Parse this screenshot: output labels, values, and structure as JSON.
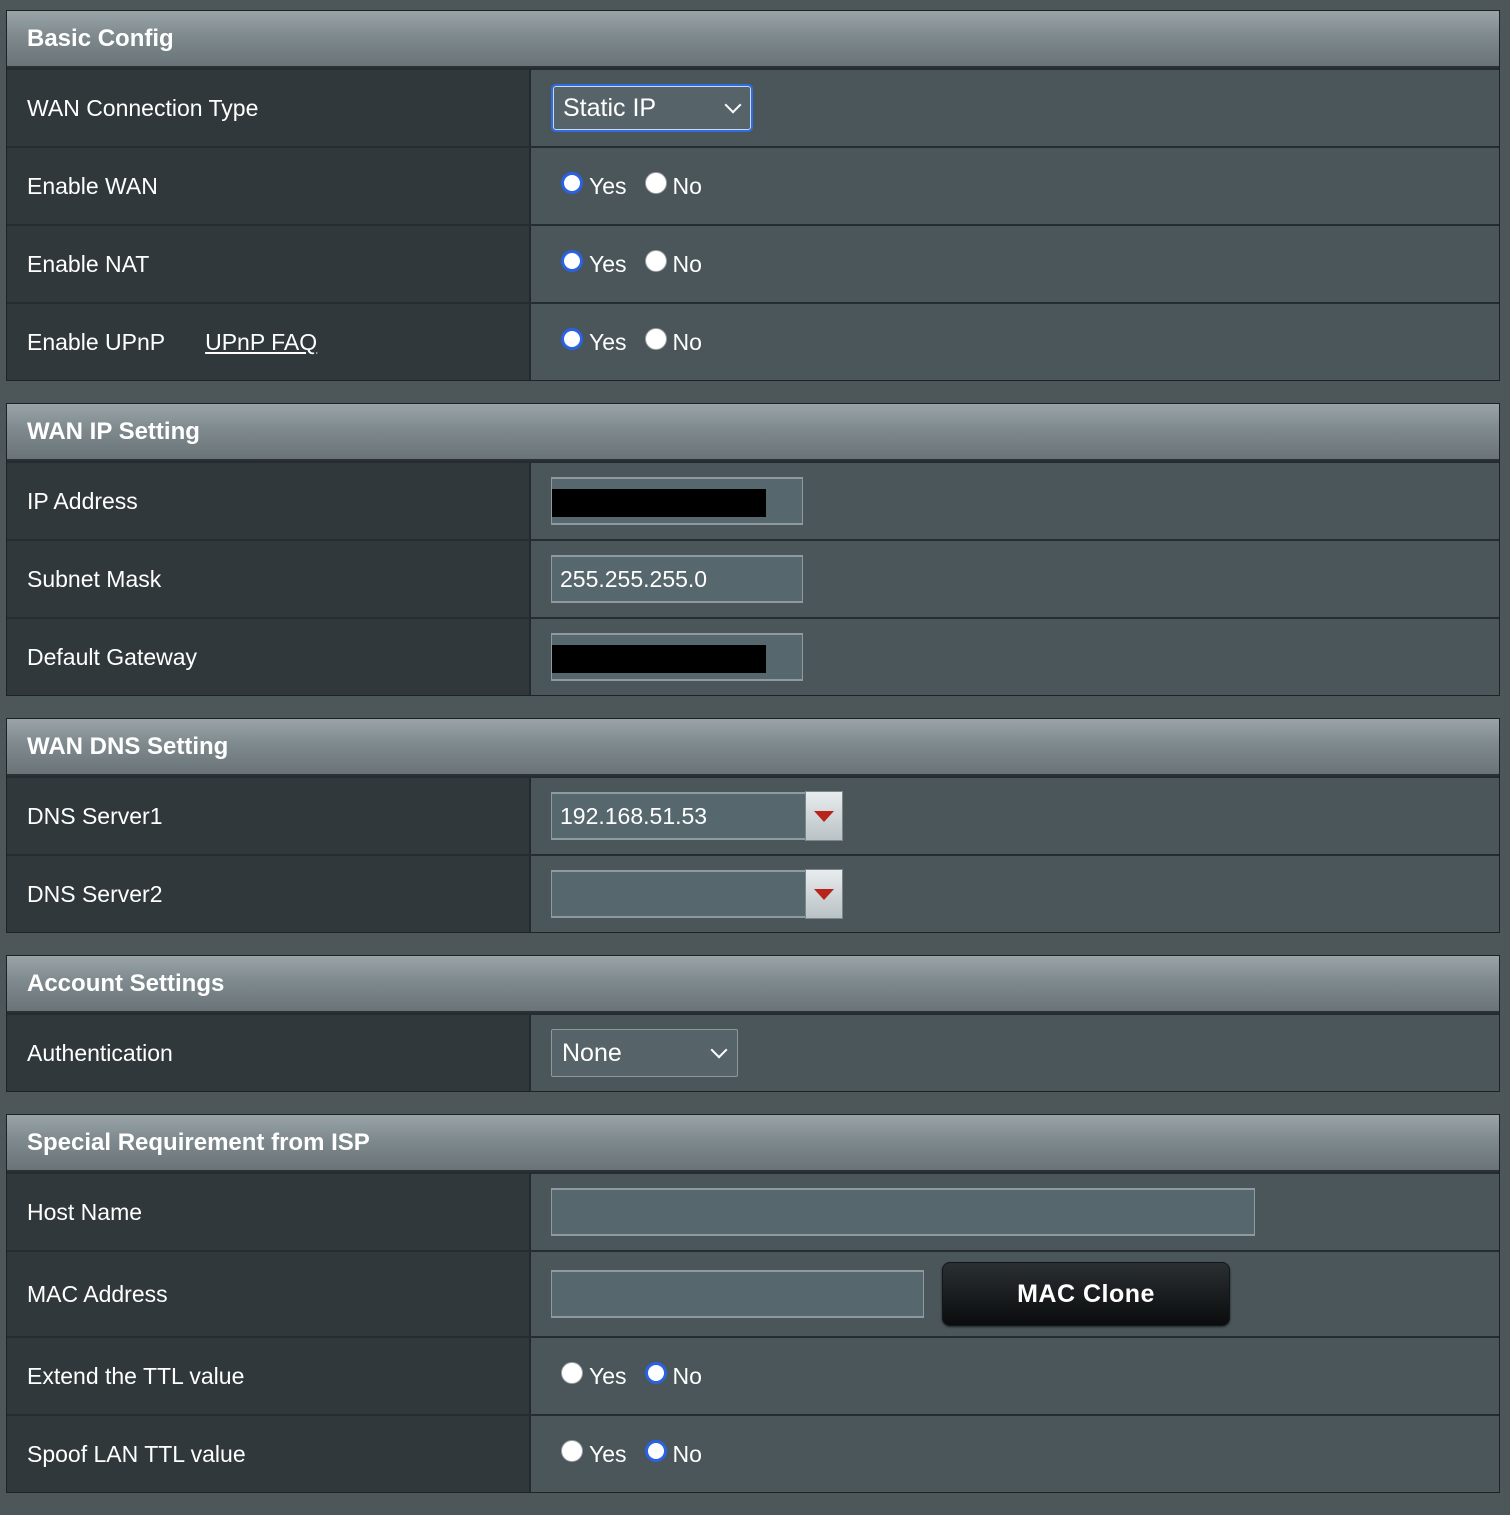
{
  "sections": {
    "basic": {
      "title": "Basic Config",
      "wan_type_label": "WAN Connection Type",
      "wan_type_value": "Static IP",
      "enable_wan_label": "Enable WAN",
      "enable_nat_label": "Enable NAT",
      "enable_upnp_label": "Enable UPnP",
      "upnp_faq": "UPnP FAQ"
    },
    "wan_ip": {
      "title": "WAN IP Setting",
      "ip_label": "IP Address",
      "subnet_label": "Subnet Mask",
      "subnet_value": "255.255.255.0",
      "gateway_label": "Default Gateway"
    },
    "wan_dns": {
      "title": "WAN DNS Setting",
      "dns1_label": "DNS Server1",
      "dns1_value": "192.168.51.53",
      "dns2_label": "DNS Server2",
      "dns2_value": ""
    },
    "account": {
      "title": "Account Settings",
      "auth_label": "Authentication",
      "auth_value": "None"
    },
    "isp": {
      "title": "Special Requirement from ISP",
      "host_label": "Host Name",
      "host_value": "",
      "mac_label": "MAC Address",
      "mac_value": "",
      "mac_clone": "MAC Clone",
      "ttl_label": "Extend the TTL value",
      "spoof_label": "Spoof LAN TTL value"
    }
  },
  "radio": {
    "yes": "Yes",
    "no": "No"
  },
  "colors": {
    "accent": "#2a62e6",
    "dropdown_arrow": "#b8241c"
  }
}
